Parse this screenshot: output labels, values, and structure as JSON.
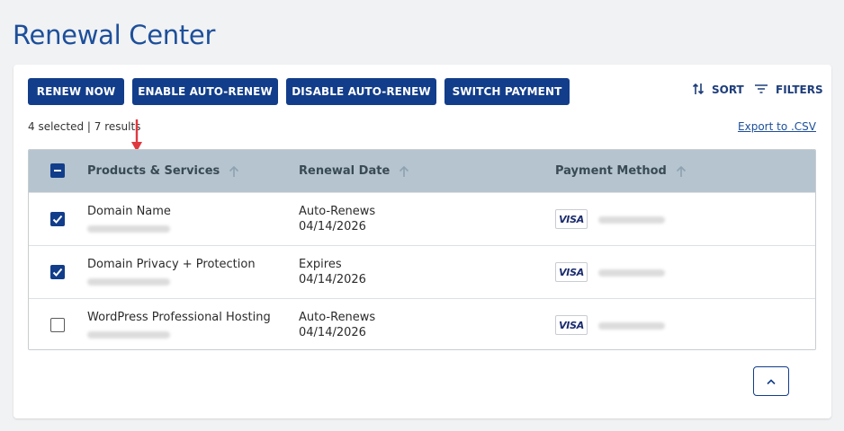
{
  "page": {
    "title": "Renewal Center"
  },
  "toolbar": {
    "buttons": [
      {
        "label": "RENEW NOW"
      },
      {
        "label": "ENABLE AUTO-RENEW"
      },
      {
        "label": "DISABLE AUTO-RENEW"
      },
      {
        "label": "SWITCH PAYMENT"
      }
    ],
    "sort_label": "SORT",
    "filters_label": "FILTERS",
    "sort_icon": "sort-arrows-icon",
    "filters_icon": "filter-lines-icon"
  },
  "summary": {
    "text": "4 selected | 7 results"
  },
  "export": {
    "label": "Export to .CSV"
  },
  "table": {
    "select_all_state": "partial",
    "columns": [
      {
        "label": "Products & Services"
      },
      {
        "label": "Renewal Date"
      },
      {
        "label": "Payment Method"
      }
    ],
    "rows": [
      {
        "checked": true,
        "product": "Domain Name",
        "status": "Auto-Renews",
        "date": "04/14/2026",
        "card": "VISA"
      },
      {
        "checked": true,
        "product": "Domain Privacy + Protection",
        "status": "Expires",
        "date": "04/14/2026",
        "card": "VISA"
      },
      {
        "checked": false,
        "product": "WordPress Professional Hosting",
        "status": "Auto-Renews",
        "date": "04/14/2026",
        "card": "VISA"
      }
    ]
  },
  "colors": {
    "primary": "#123d8a",
    "title": "#1d4f9a",
    "header_bg": "#b5c4cf",
    "annotation_arrow": "#e0383e"
  }
}
